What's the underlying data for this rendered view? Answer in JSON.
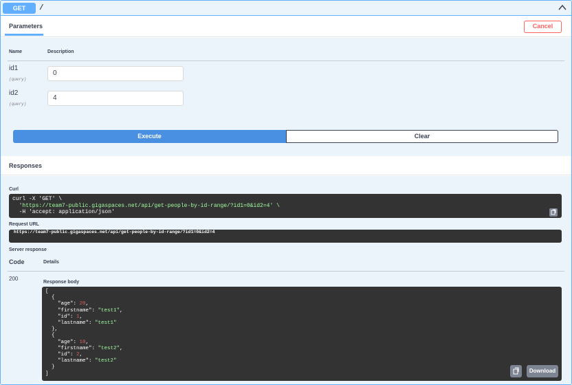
{
  "operation": {
    "method": "GET",
    "path": "/",
    "collapse_icon": "chevron-up-icon",
    "accent_color": "#61affe"
  },
  "parameters": {
    "tab_label": "Parameters",
    "cancel_label": "Cancel",
    "columns": {
      "name": "Name",
      "description": "Description"
    },
    "items": [
      {
        "name": "id1",
        "in": "(query)",
        "value": "0"
      },
      {
        "name": "id2",
        "in": "(query)",
        "value": "4"
      }
    ],
    "execute_label": "Execute",
    "clear_label": "Clear"
  },
  "responses": {
    "title": "Responses",
    "curl_label": "Curl",
    "curl_lines": [
      "curl -X 'GET' \\",
      "  'https://team7-public.gigaspaces.net/api/get-people-by-id-range/?id1=0&id2=4' \\",
      "  -H 'accept: application/json'"
    ],
    "request_url_label": "Request URL",
    "request_url": "https://team7-public.gigaspaces.net/api/get-people-by-id-range/?id1=0&id2=4",
    "server_response_label": "Server response",
    "code_header": "Code",
    "details_header": "Details",
    "code": "200",
    "response_body_label": "Response body",
    "body_lines": [
      "[",
      "  {",
      "    \"age\": 20,",
      "    \"firstname\": \"test1\",",
      "    \"id\": 1,",
      "    \"lastname\": \"test1\"",
      "  },",
      "  {",
      "    \"age\": 10,",
      "    \"firstname\": \"test2\",",
      "    \"id\": 2,",
      "    \"lastname\": \"test2\"",
      "  }",
      "]"
    ],
    "download_label": "Download",
    "copy_icon": "clipboard-copy-icon"
  }
}
